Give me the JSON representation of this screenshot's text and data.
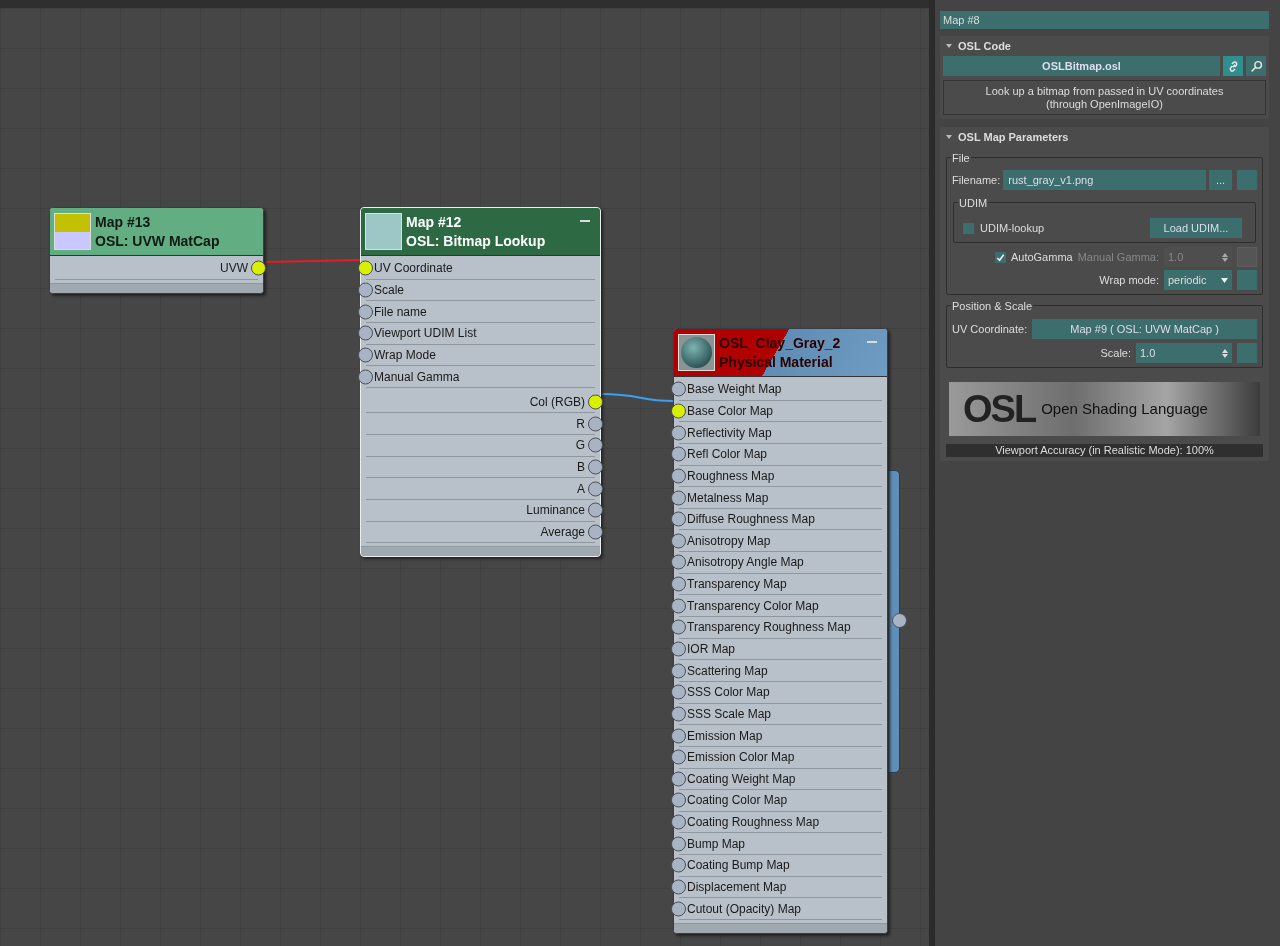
{
  "nodes": [
    {
      "kind": "map",
      "selected": false,
      "title": "Map #13",
      "subtitle": "OSL: UVW MatCap",
      "minimizable": false,
      "outputs": [
        {
          "label": "UVW",
          "connected": true
        }
      ]
    },
    {
      "kind": "map",
      "selected": true,
      "title": "Map #12",
      "subtitle": "OSL: Bitmap Lookup",
      "minimizable": true,
      "inputs": [
        {
          "label": "UV Coordinate",
          "connected": true
        },
        {
          "label": "Scale",
          "connected": false
        },
        {
          "label": "File name",
          "connected": false
        },
        {
          "label": "Viewport UDIM List",
          "connected": false
        },
        {
          "label": "Wrap Mode",
          "connected": false
        },
        {
          "label": "Manual Gamma",
          "connected": false
        }
      ],
      "outputs": [
        {
          "label": "Col (RGB)",
          "connected": true
        },
        {
          "label": "R",
          "connected": false
        },
        {
          "label": "G",
          "connected": false
        },
        {
          "label": "B",
          "connected": false
        },
        {
          "label": "A",
          "connected": false
        },
        {
          "label": "Luminance",
          "connected": false
        },
        {
          "label": "Average",
          "connected": false
        }
      ]
    },
    {
      "kind": "material",
      "selected": false,
      "title": "OSL_Clay_Gray_2",
      "subtitle": "Physical Material",
      "minimizable": true,
      "inputs": [
        {
          "label": "Base Weight Map",
          "connected": false
        },
        {
          "label": "Base Color Map",
          "connected": true
        },
        {
          "label": "Reflectivity Map",
          "connected": false
        },
        {
          "label": "Refl Color Map",
          "connected": false
        },
        {
          "label": "Roughness Map",
          "connected": false
        },
        {
          "label": "Metalness Map",
          "connected": false
        },
        {
          "label": "Diffuse Roughness Map",
          "connected": false
        },
        {
          "label": "Anisotropy Map",
          "connected": false
        },
        {
          "label": "Anisotropy Angle Map",
          "connected": false
        },
        {
          "label": "Transparency Map",
          "connected": false
        },
        {
          "label": "Transparency Color Map",
          "connected": false
        },
        {
          "label": "Transparency Roughness Map",
          "connected": false
        },
        {
          "label": "IOR Map",
          "connected": false
        },
        {
          "label": "Scattering Map",
          "connected": false
        },
        {
          "label": "SSS Color Map",
          "connected": false
        },
        {
          "label": "SSS Scale Map",
          "connected": false
        },
        {
          "label": "Emission Map",
          "connected": false
        },
        {
          "label": "Emission Color Map",
          "connected": false
        },
        {
          "label": "Coating Weight Map",
          "connected": false
        },
        {
          "label": "Coating Color Map",
          "connected": false
        },
        {
          "label": "Coating Roughness Map",
          "connected": false
        },
        {
          "label": "Bump Map",
          "connected": false
        },
        {
          "label": "Coating Bump Map",
          "connected": false
        },
        {
          "label": "Displacement Map",
          "connected": false
        },
        {
          "label": "Cutout (Opacity) Map",
          "connected": false
        }
      ]
    }
  ],
  "panel": {
    "map_name": "Map #8",
    "osl_code": {
      "title": "OSL Code",
      "expanded": true,
      "file_button": "OSLBitmap.osl",
      "link_active": true,
      "description": "Look up a bitmap from passed in UV coordinates\n(through OpenImageIO)"
    },
    "parameters": {
      "title": "OSL Map Parameters",
      "expanded": true,
      "file_group": {
        "title": "File",
        "filename_label": "Filename:",
        "filename": "rust_gray_v1.png",
        "browse_button": "...",
        "udim": {
          "title": "UDIM",
          "lookup_label": "UDIM-lookup",
          "lookup_checked": false,
          "load_button": "Load UDIM..."
        },
        "autogamma_label": "AutoGamma",
        "autogamma_checked": true,
        "manual_gamma_label": "Manual Gamma:",
        "manual_gamma": "1.0",
        "manual_gamma_disabled": true,
        "wrap_label": "Wrap mode:",
        "wrap_value": "periodic"
      },
      "position_group": {
        "title": "Position & Scale",
        "uv_label": "UV Coordinate:",
        "uv_value": "Map #9  ( OSL: UVW MatCap )",
        "scale_label": "Scale:",
        "scale_value": "1.0"
      },
      "logo": {
        "mark": "OSL",
        "text": "Open Shading Language"
      },
      "accuracy": "Viewport Accuracy (in Realistic Mode): 100%"
    }
  }
}
